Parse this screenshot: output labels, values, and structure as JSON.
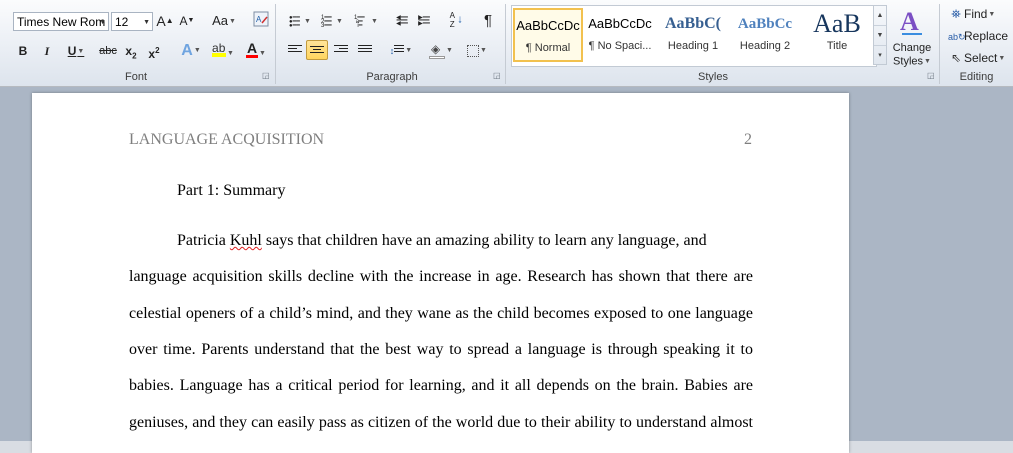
{
  "font": {
    "font_name": "Times New Rom",
    "font_size": "12",
    "grow_label": "A",
    "shrink_label": "A",
    "change_case_label": "Aa",
    "bold_label": "B",
    "italic_label": "I",
    "underline_label": "U",
    "strike_label": "abc",
    "subscript_label": "x",
    "superscript_label": "x",
    "text_effects_label": "A",
    "font_color_label": "A",
    "group_label": "Font"
  },
  "paragraph": {
    "group_label": "Paragraph",
    "sort_label": "A Z",
    "pilcrow": "¶"
  },
  "styles": {
    "group_label": "Styles",
    "items": [
      {
        "sample": "AaBbCcDc",
        "name": "¶ Normal"
      },
      {
        "sample": "AaBbCcDc",
        "name": "¶ No Spaci..."
      },
      {
        "sample": "AaBbC(",
        "name": "Heading 1"
      },
      {
        "sample": "AaBbCc",
        "name": "Heading 2"
      },
      {
        "sample": "AaB",
        "name": "Title"
      }
    ],
    "change_styles_line1": "Change",
    "change_styles_line2": "Styles"
  },
  "editing": {
    "group_label": "Editing",
    "find_label": "Find",
    "replace_label": "Replace",
    "select_label": "Select"
  },
  "colors": {
    "highlight": "#ffff00",
    "font_color": "#ff0000",
    "accent": "#1f5ea8"
  },
  "document": {
    "running_head": "LANGUAGE ACQUISITION",
    "page_number": "2",
    "heading": "Part 1: Summary",
    "misspelled_word": "Kuhl",
    "line1_pre": "Patricia ",
    "line1_post": " says that children have an amazing ability to learn any language, and",
    "line2": "language acquisition skills decline with the increase in age. Research has shown that there are",
    "line3": "celestial openers of a child’s mind, and they wane as the child becomes exposed to one language",
    "line4": "over time. Parents understand that the best way to spread a language is through speaking it to",
    "line5": "babies. Language has a critical period for learning, and it all depends on the brain. Babies are",
    "line6": "geniuses, and they can easily pass as citizen of the world due to their ability to understand almost"
  }
}
